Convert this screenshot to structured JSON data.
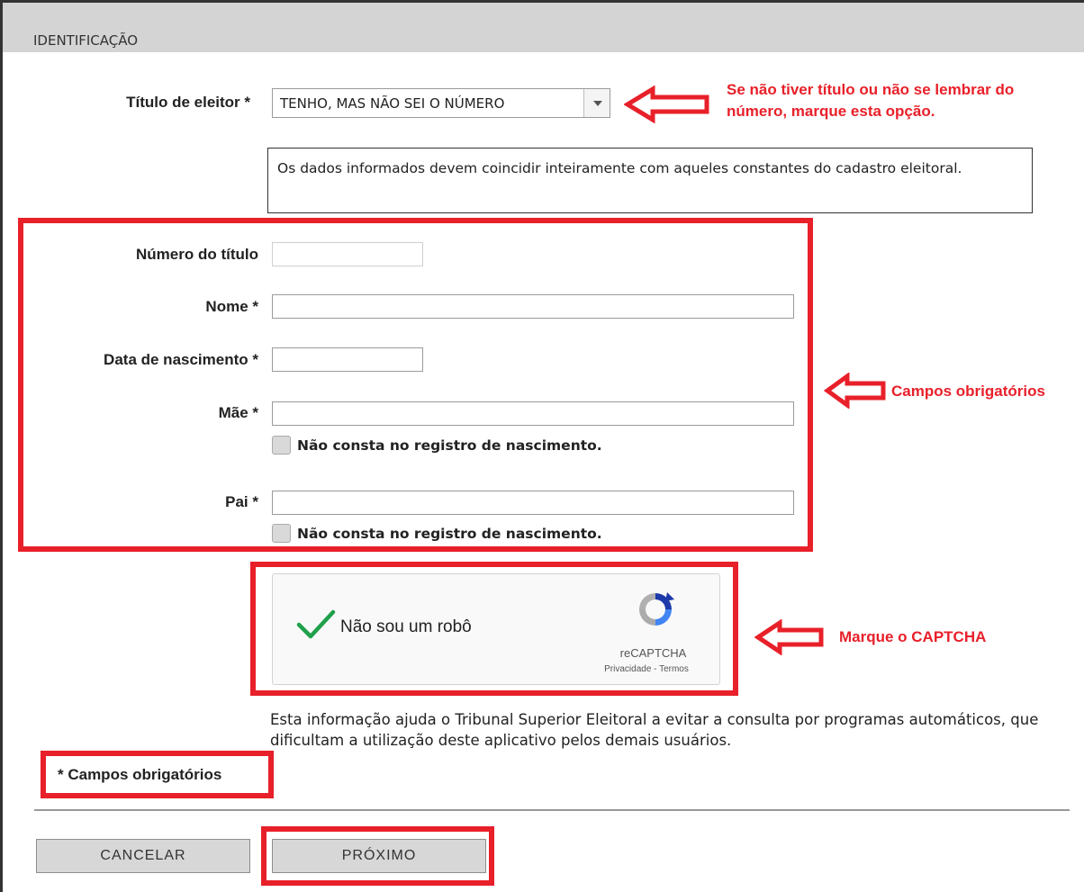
{
  "header": {
    "title": "IDENTIFICAÇÃO"
  },
  "form": {
    "titulo_label": "Título de eleitor *",
    "titulo_value": "TENHO, MAS NÃO SEI O NÚMERO",
    "info": "Os dados informados devem coincidir inteiramente com aqueles constantes do cadastro eleitoral.",
    "numero_label": "Número do título",
    "numero_value": "",
    "nome_label": "Nome *",
    "nome_value": "",
    "nascimento_label": "Data de nascimento *",
    "nascimento_value": "",
    "mae_label": "Mãe *",
    "mae_value": "",
    "mae_checkbox_label": "Não consta no registro de nascimento.",
    "pai_label": "Pai *",
    "pai_value": "",
    "pai_checkbox_label": "Não consta no registro de nascimento."
  },
  "captcha": {
    "label": "Não sou um robô",
    "brand": "reCAPTCHA",
    "links": "Privacidade - Termos",
    "note": "Esta informação ajuda o Tribunal Superior Eleitoral a evitar a consulta por programas automáticos, que dificultam a utilização deste aplicativo pelos demais usuários."
  },
  "required_note": "* Campos obrigatórios",
  "buttons": {
    "cancel": "CANCELAR",
    "next": "PRÓXIMO"
  },
  "annotations": {
    "select_hint_line1": "Se não tiver título ou não se lembrar do",
    "select_hint_line2": "número, marque esta opção.",
    "required_hint": "Campos obrigatórios",
    "captcha_hint": "Marque o CAPTCHA"
  },
  "colors": {
    "annotation_red": "#e8202a",
    "header_bg": "#d4d4d4",
    "check_green": "#1fa04a"
  }
}
